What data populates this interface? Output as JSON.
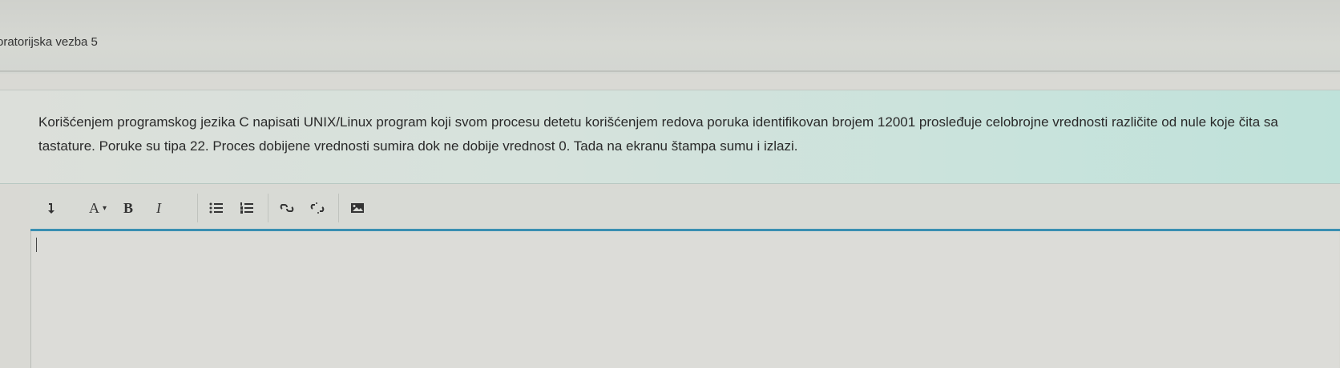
{
  "page": {
    "title": "oratorijska vezba 5"
  },
  "question": {
    "text": "Korišćenjem programskog jezika C napisati UNIX/Linux program koji svom procesu detetu korišćenjem redova poruka identifikovan brojem 12001 prosleđuje celobrojne vrednosti različite od nule koje čita sa tastature. Poruke su tipa 22. Proces dobijene vrednosti sumira dok ne dobije vrednost 0. Tada na ekranu štampa sumu i izlazi."
  },
  "editor": {
    "toolbar": {
      "expand_icon": "expand-toolbar-icon",
      "font_label": "A",
      "font_caret": "▾",
      "bold_label": "B",
      "italic_label": "I",
      "bullet_list_icon": "unordered-list-icon",
      "numbered_list_icon": "ordered-list-icon",
      "link_icon": "link-icon",
      "unlink_icon": "unlink-icon",
      "image_icon": "image-icon"
    },
    "content": ""
  },
  "colors": {
    "toolbar_underline": "#3a8fb2",
    "question_bg": "#c9e3dc"
  }
}
